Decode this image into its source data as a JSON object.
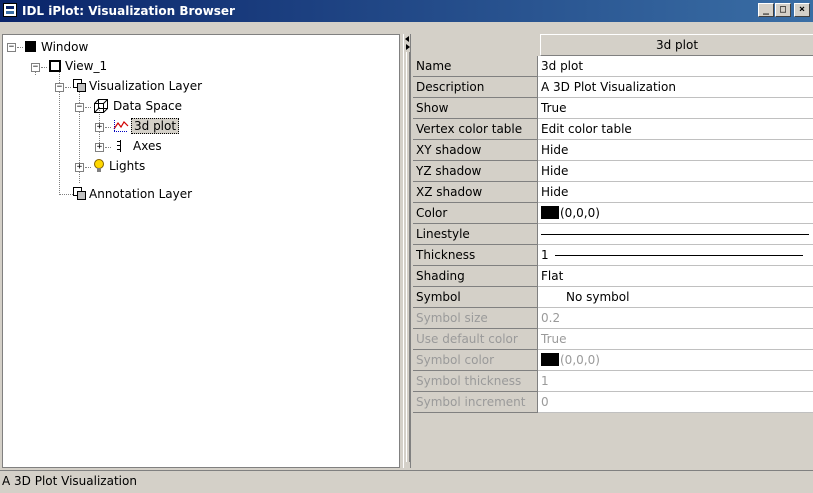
{
  "window": {
    "title": "IDL iPlot: Visualization Browser"
  },
  "window_buttons": {
    "minimize": "_",
    "maximize": "□",
    "close": "×"
  },
  "tree": {
    "window": "Window",
    "view": "View_1",
    "vis_layer": "Visualization Layer",
    "data_space": "Data Space",
    "plot": "3d plot",
    "axes": "Axes",
    "lights": "Lights",
    "annotation_layer": "Annotation Layer"
  },
  "properties": {
    "column_header": "3d plot",
    "rows": [
      {
        "name": "Name",
        "value": "3d plot"
      },
      {
        "name": "Description",
        "value": "A 3D Plot Visualization"
      },
      {
        "name": "Show",
        "value": "True"
      },
      {
        "name": "Vertex color table",
        "value": "Edit color table"
      },
      {
        "name": "XY shadow",
        "value": "Hide"
      },
      {
        "name": "YZ shadow",
        "value": "Hide"
      },
      {
        "name": "XZ shadow",
        "value": "Hide"
      },
      {
        "name": "Color",
        "value": "(0,0,0)"
      },
      {
        "name": "Linestyle",
        "value": ""
      },
      {
        "name": "Thickness",
        "value": "1"
      },
      {
        "name": "Shading",
        "value": "Flat"
      },
      {
        "name": "Symbol",
        "value": "No symbol"
      },
      {
        "name": "Symbol size",
        "value": "0.2"
      },
      {
        "name": "Use default color",
        "value": "True"
      },
      {
        "name": "Symbol color",
        "value": "(0,0,0)"
      },
      {
        "name": "Symbol thickness",
        "value": "1"
      },
      {
        "name": "Symbol increment",
        "value": "0"
      }
    ]
  },
  "status": {
    "text": "A 3D Plot Visualization"
  },
  "colors": {
    "title_start": "#0a246a",
    "title_end": "#3a6ea5",
    "face": "#d4d0c8",
    "disabled_text": "#9a9a9a"
  }
}
